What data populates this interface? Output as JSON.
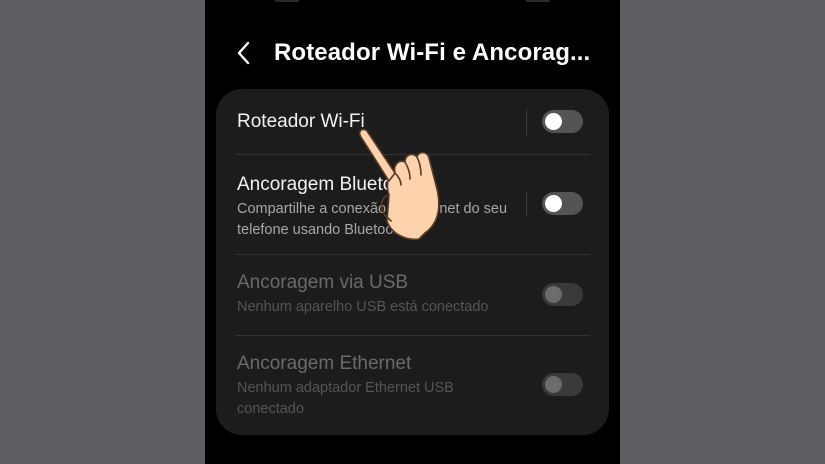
{
  "header": {
    "title": "Roteador Wi-Fi e Ancorag..."
  },
  "settings": [
    {
      "title": "Roteador Wi-Fi",
      "subtitle": "",
      "enabled": true,
      "toggle_on": false
    },
    {
      "title": "Ancoragem Bluetooth",
      "subtitle": "Compartilhe a conexão de Internet do seu telefone usando Bluetooth.",
      "enabled": true,
      "toggle_on": false
    },
    {
      "title": "Ancoragem via USB",
      "subtitle": "Nenhum aparelho USB está conectado",
      "enabled": false,
      "toggle_on": false
    },
    {
      "title": "Ancoragem Ethernet",
      "subtitle": "Nenhum adaptador Ethernet USB conectado",
      "enabled": false,
      "toggle_on": false
    }
  ],
  "icons": {
    "back": "chevron-left-icon",
    "pointer": "tapping-hand-icon"
  },
  "colors": {
    "page_bg": "#5e5e62",
    "screen_bg": "#000000",
    "card_bg": "#1c1c1c",
    "toggle_off": "#545454",
    "hand_skin": "#fcd3ad"
  }
}
